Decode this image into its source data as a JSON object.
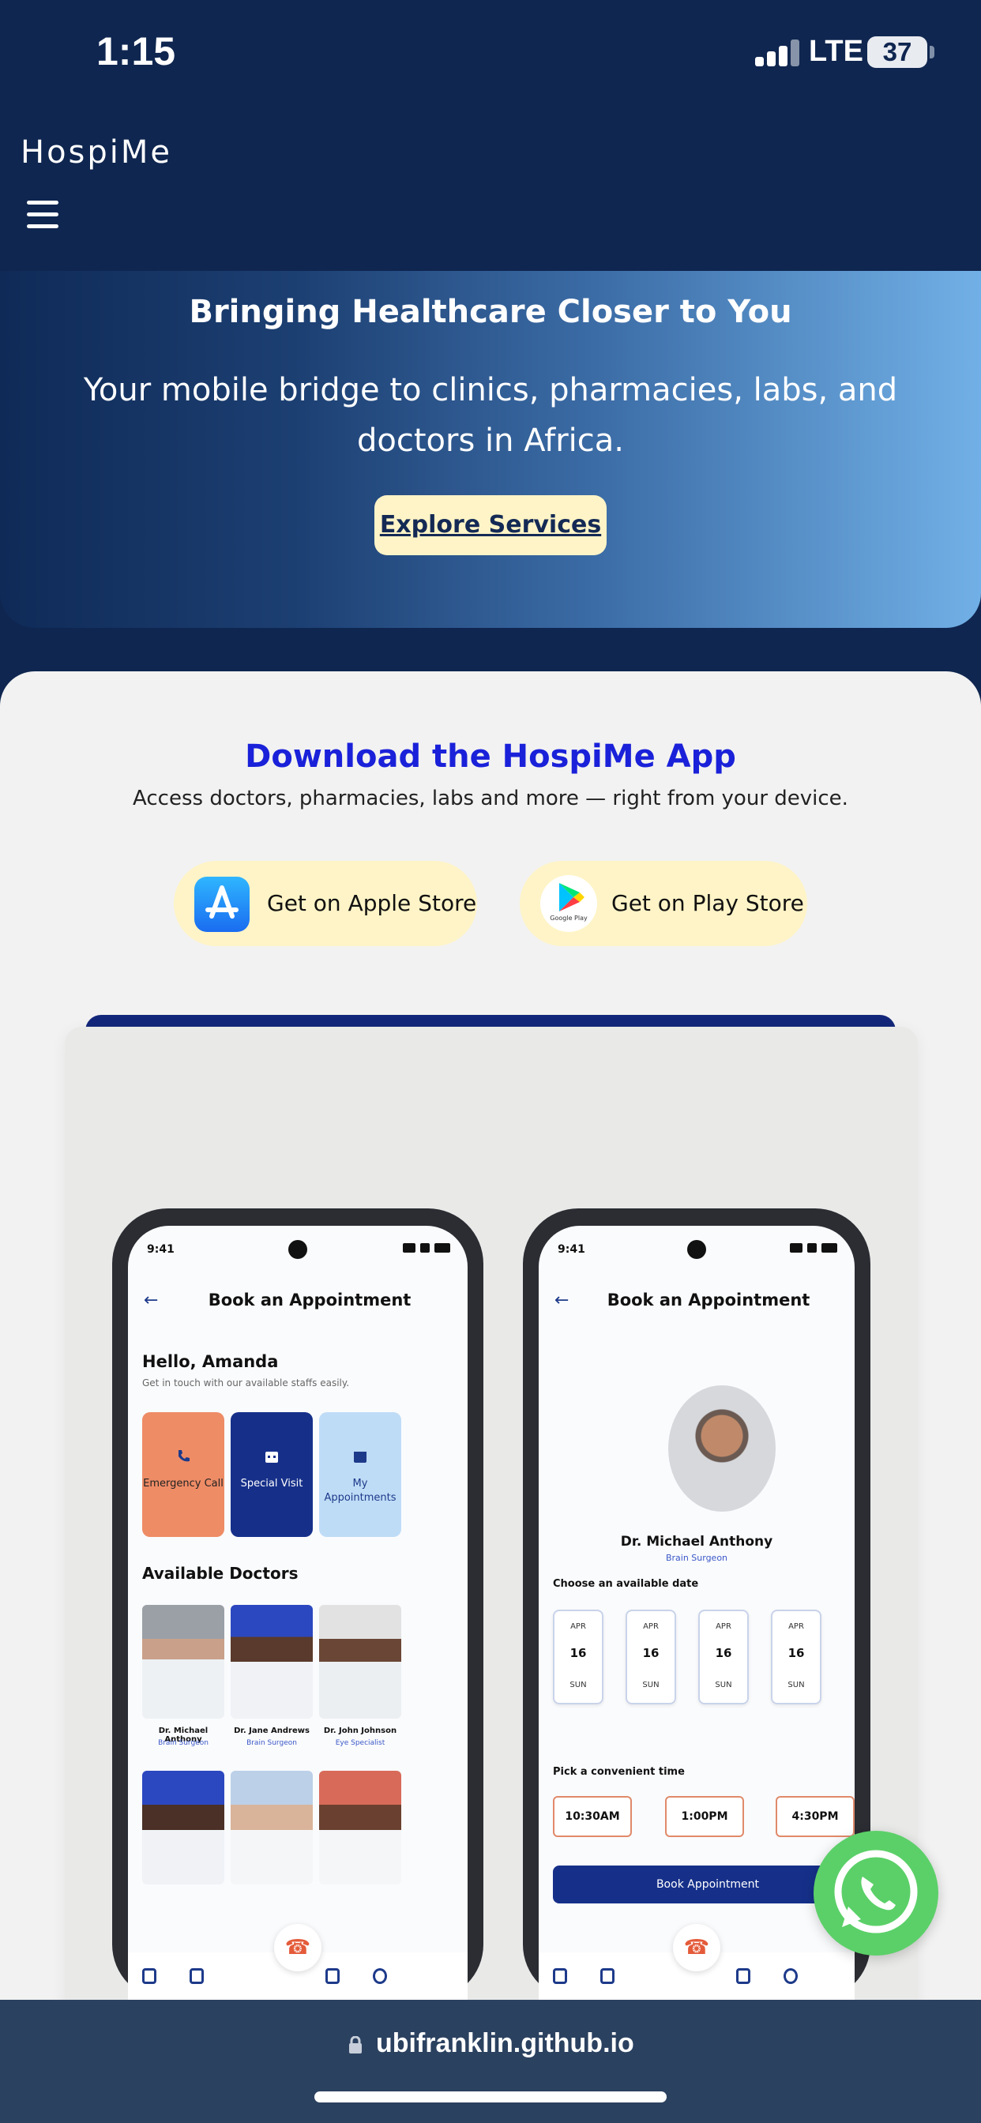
{
  "status_bar": {
    "time": "1:15",
    "network": "LTE",
    "battery": "37"
  },
  "header": {
    "brand": "HospiMe"
  },
  "hero": {
    "title": "Bringing Healthcare Closer to You",
    "subtitle": "Your mobile bridge to clinics, pharmacies, labs, and doctors in Africa.",
    "cta_label": "Explore Services"
  },
  "download": {
    "title": "Download the HospiMe App",
    "subtitle": "Access doctors, pharmacies, labs and more — right from your device.",
    "apple_label": "Get on Apple Store",
    "play_label": "Get on Play Store",
    "play_badge": "Google Play"
  },
  "mockup": {
    "left": {
      "time": "9:41",
      "title": "Book an Appointment",
      "greeting": "Hello, Amanda",
      "greeting_sub": "Get in touch with our available staffs easily.",
      "tiles": [
        "Emergency Call",
        "Special Visit",
        "My Appointments"
      ],
      "section": "Available Doctors",
      "doctors": [
        {
          "name": "Dr. Michael Anthony",
          "role": "Brain Surgeon"
        },
        {
          "name": "Dr. Jane Andrews",
          "role": "Brain Surgeon"
        },
        {
          "name": "Dr. John Johnson",
          "role": "Eye Specialist"
        }
      ]
    },
    "right": {
      "time": "9:41",
      "title": "Book an Appointment",
      "doctor_name": "Dr. Michael Anthony",
      "doctor_role": "Brain Surgeon",
      "date_label": "Choose an available date",
      "dates": [
        {
          "month": "APR",
          "day": "16",
          "weekday": "SUN"
        },
        {
          "month": "APR",
          "day": "16",
          "weekday": "SUN"
        },
        {
          "month": "APR",
          "day": "16",
          "weekday": "SUN"
        },
        {
          "month": "APR",
          "day": "16",
          "weekday": "SUN"
        }
      ],
      "time_label": "Pick a convenient time",
      "times": [
        "10:30AM",
        "1:00PM",
        "4:30PM"
      ],
      "book_label": "Book Appointment"
    }
  },
  "browser": {
    "url": "ubifranklin.github.io"
  },
  "colors": {
    "navy": "#0f2650",
    "accent_blue": "#1a21d9",
    "button_cream": "#fff4c7",
    "whatsapp_green": "#5bd068"
  }
}
